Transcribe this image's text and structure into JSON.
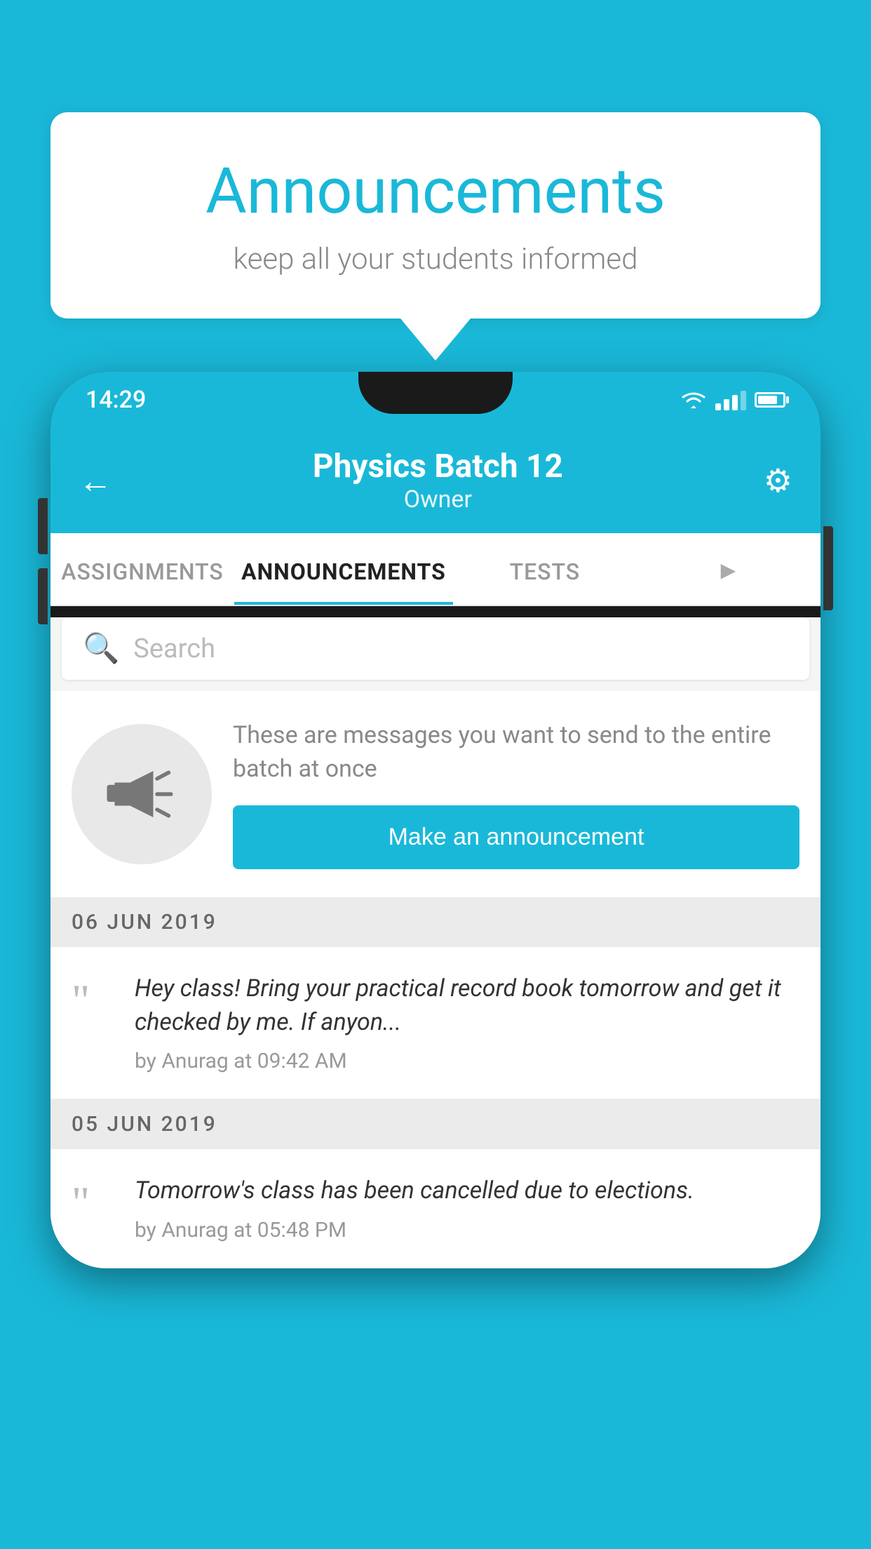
{
  "background_color": "#1ab8d8",
  "speech_bubble": {
    "title": "Announcements",
    "subtitle": "keep all your students informed"
  },
  "phone": {
    "status_bar": {
      "time": "14:29"
    },
    "header": {
      "back_label": "←",
      "title": "Physics Batch 12",
      "subtitle": "Owner",
      "settings_icon": "⚙"
    },
    "tabs": [
      {
        "label": "ASSIGNMENTS",
        "active": false
      },
      {
        "label": "ANNOUNCEMENTS",
        "active": true
      },
      {
        "label": "TESTS",
        "active": false
      },
      {
        "label": "•••",
        "active": false
      }
    ],
    "search": {
      "placeholder": "Search"
    },
    "promo": {
      "description": "These are messages you want to send to the entire batch at once",
      "button_label": "Make an announcement"
    },
    "announcements": [
      {
        "date": "06  JUN  2019",
        "items": [
          {
            "content": "Hey class! Bring your practical record book tomorrow and get it checked by me. If anyon...",
            "meta": "by Anurag at 09:42 AM"
          }
        ]
      },
      {
        "date": "05  JUN  2019",
        "items": [
          {
            "content": "Tomorrow's class has been cancelled due to elections.",
            "meta": "by Anurag at 05:48 PM"
          }
        ]
      }
    ]
  }
}
